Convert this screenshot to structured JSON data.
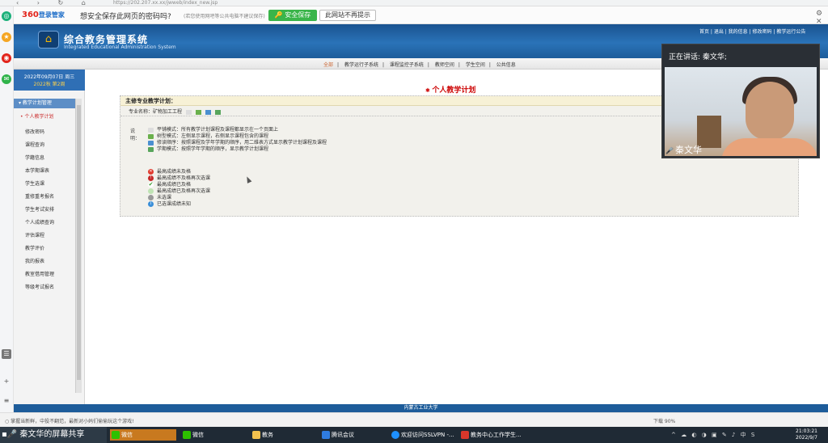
{
  "browser": {
    "url": "https://202.207.xx.xx/jwweb/index_new.jsp",
    "nav_glyphs": "‹ › ↻ ⌂"
  },
  "password_bar": {
    "brand_360": "360",
    "brand_text": "登录管家",
    "question": "想安全保存此网页的密码吗?",
    "tip": "(若您使用网吧等公共电脑不建议保存)",
    "save_label": "安全保存",
    "no_prompt_label": "此网站不再提示"
  },
  "header": {
    "title": "综合教务管理系统",
    "subtitle": "Integrated Educational Administration System",
    "links": "首页 | 退出 | 我的信息 | 修改密码 | 教学运行公告"
  },
  "menu": {
    "items": [
      "全部",
      "教学运行子系统",
      "课程监控子系统",
      "教师空间",
      "学生空间",
      "公共信息"
    ]
  },
  "sidebar": {
    "date": "2022年09月07日 周三",
    "term": "2022秋 第2周",
    "group": "教学计划管理",
    "active_sub": "个人教学计划",
    "items": [
      "修改密码",
      "课程查询",
      "学籍信息",
      "本学期课表",
      "学生选课",
      "重修重考报名",
      "学生考试安排",
      "个人成绩查询",
      "评估课程",
      "教学评价",
      "我的报表",
      "教室借用管理",
      "等级考试报名"
    ]
  },
  "main": {
    "page_title": "个人教学计划",
    "panel_head": "主修专业教学计划：",
    "major_label": "专业名称：矿物加工工程",
    "legend_label": "说明：",
    "modes": [
      "平铺模式：所有教学计划课程及课程都显示在一个页面上",
      "树型模式：左侧显示课程，右侧显示课程包含的课程",
      "修读顺序：按照课程及学年学期的顺序，用二维表方式显示教学计划课程及课程",
      "学期模式：按照学年学期的顺序，显示教学计划课程"
    ],
    "statuses": [
      "最高成绩未及格",
      "最高成绩不及格再次选课",
      "最高成绩已及格",
      "最高成绩已及格再次选课",
      "未选课",
      "已选课成绩未知"
    ]
  },
  "footer": {
    "text": "内蒙古工业大学"
  },
  "statusbar": {
    "message": "○ 掌握当新鲜，中投不翻范，最新对小妈们偷偷玩这个游戏!",
    "right": "下载   90%"
  },
  "taskbar": {
    "share": "秦文华的屏幕共享",
    "apps": [
      "微信",
      "微信",
      "教务",
      "腾讯会议",
      "欢迎访问SSLVPN -...",
      "教务中心工作学生..."
    ],
    "time": "21:03:21",
    "date": "2022/9/7",
    "ime": "中"
  },
  "video": {
    "speaking": "正在讲话: 秦文华;",
    "name": "秦文华"
  },
  "colors": {
    "header_blue": "#2a73b8",
    "title_red": "#cc0000",
    "save_green": "#3ab54a"
  }
}
